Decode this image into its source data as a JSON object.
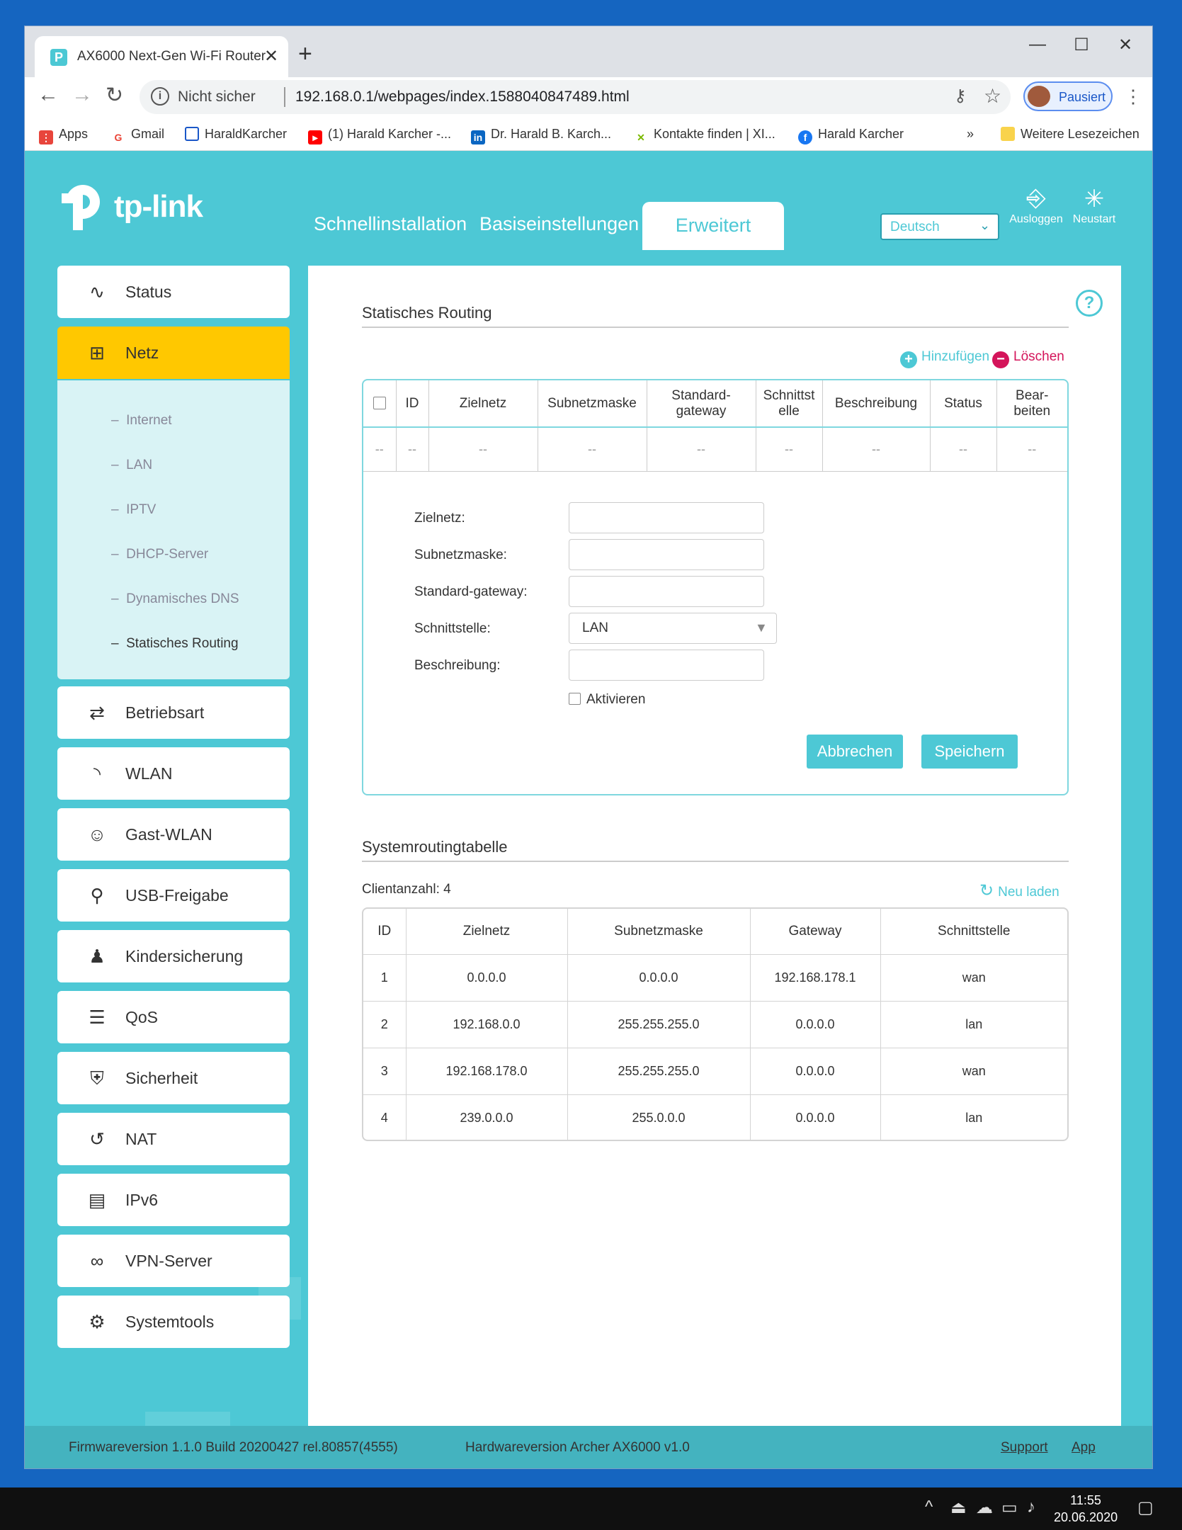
{
  "browser": {
    "tab_title": "AX6000 Next-Gen Wi-Fi Router",
    "not_secure": "Nicht sicher",
    "url": "192.168.0.1/webpages/index.1588040847489.html",
    "profile_label": "Pausiert",
    "bookmarks": [
      {
        "label": "Apps",
        "icon": "apps-grid-icon",
        "color": "#e8453c"
      },
      {
        "label": "Gmail",
        "icon": "google-icon",
        "color": "#4285f4"
      },
      {
        "label": "HaraldKarcher",
        "icon": "page-icon",
        "color": "#1a57c8"
      },
      {
        "label": "(1) Harald Karcher -...",
        "icon": "youtube-icon",
        "color": "#ff0000"
      },
      {
        "label": "Dr. Harald B. Karch...",
        "icon": "linkedin-icon",
        "color": "#0a66c2"
      },
      {
        "label": "Kontakte finden | XI...",
        "icon": "xing-icon",
        "color": "#7ab800"
      },
      {
        "label": "Harald Karcher",
        "icon": "facebook-icon",
        "color": "#1877f2"
      }
    ],
    "more_bookmarks": "»",
    "other_bookmarks": "Weitere Lesezeichen"
  },
  "router": {
    "brand": "tp-link",
    "main_tabs": [
      "Schnellinstallation",
      "Basiseinstellungen",
      "Erweitert"
    ],
    "language": "Deutsch",
    "logout": "Ausloggen",
    "reboot": "Neustart",
    "sidebar": {
      "status": "Status",
      "netz": "Netz",
      "sub": [
        "Internet",
        "LAN",
        "IPTV",
        "DHCP-Server",
        "Dynamisches DNS",
        "Statisches Routing"
      ],
      "items": [
        "Betriebsart",
        "WLAN",
        "Gast-WLAN",
        "USB-Freigabe",
        "Kindersicherung",
        "QoS",
        "Sicherheit",
        "NAT",
        "IPv6",
        "VPN-Server",
        "Systemtools"
      ]
    },
    "static_routing": {
      "title": "Statisches Routing",
      "add": "Hinzufügen",
      "delete": "Löschen",
      "columns": [
        "ID",
        "Zielnetz",
        "Subnetzmaske",
        "Standard-gateway",
        "Schnittstelle",
        "Beschreibung",
        "Status",
        "Bear-beiten"
      ],
      "empty_cell": "--",
      "form": {
        "dest_label": "Zielnetz:",
        "mask_label": "Subnetzmaske:",
        "gw_label": "Standard-gateway:",
        "iface_label": "Schnittstelle:",
        "iface_value": "LAN",
        "desc_label": "Beschreibung:",
        "enable_label": "Aktivieren",
        "cancel": "Abbrechen",
        "save": "Speichern"
      }
    },
    "system_routing": {
      "title": "Systemroutingtabelle",
      "client_count": "Clientanzahl: 4",
      "reload": "Neu laden",
      "columns": [
        "ID",
        "Zielnetz",
        "Subnetzmaske",
        "Gateway",
        "Schnittstelle"
      ],
      "rows": [
        [
          "1",
          "0.0.0.0",
          "0.0.0.0",
          "192.168.178.1",
          "wan"
        ],
        [
          "2",
          "192.168.0.0",
          "255.255.255.0",
          "0.0.0.0",
          "lan"
        ],
        [
          "3",
          "192.168.178.0",
          "255.255.255.0",
          "0.0.0.0",
          "wan"
        ],
        [
          "4",
          "239.0.0.0",
          "255.0.0.0",
          "0.0.0.0",
          "lan"
        ]
      ]
    },
    "footer": {
      "firmware": "Firmwareversion 1.1.0 Build 20200427 rel.80857(4555)",
      "hardware": "Hardwareversion Archer AX6000 v1.0",
      "support": "Support",
      "app": "App"
    }
  },
  "taskbar": {
    "time": "11:55",
    "date": "20.06.2020"
  },
  "colors": {
    "accent": "#4dc8d5",
    "active_nav": "#ffc800",
    "delete": "#d4145a"
  }
}
